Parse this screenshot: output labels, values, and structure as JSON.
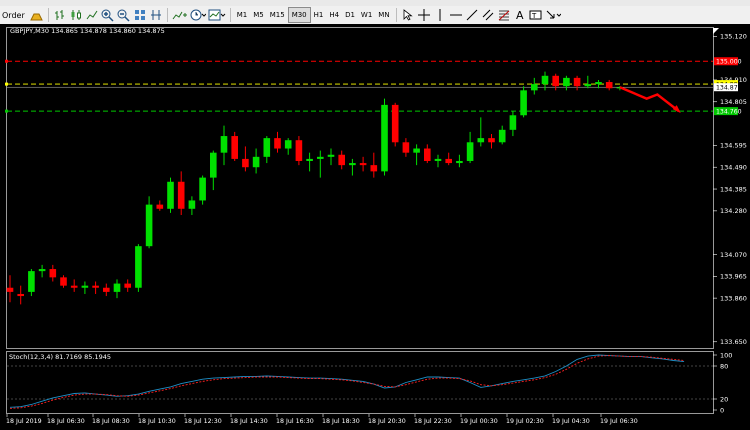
{
  "toolbar": {
    "order_label": "Order",
    "timeframes": [
      "M1",
      "M5",
      "M15",
      "M30",
      "H1",
      "H4",
      "D1",
      "W1",
      "MN"
    ],
    "active_timeframe": "M30",
    "icons": [
      "gold-bars-icon",
      "bar-chart-icon",
      "candlestick-icon",
      "line-chart-icon",
      "zoom-in-icon",
      "zoom-out-icon",
      "tile-windows-icon",
      "period-separators-icon",
      "add-indicator-icon",
      "clock-icon",
      "templates-icon",
      "cursor-icon",
      "crosshair-icon",
      "vertical-line-icon",
      "horizontal-line-icon",
      "trendline-icon",
      "channel-icon",
      "fibonacci-icon",
      "text-icon",
      "text-label-icon",
      "arrows-icon"
    ]
  },
  "chart_info": {
    "symbol_line": "GBPJPY,M30  134.865 134.878 134.860 134.875"
  },
  "indicator_info": {
    "label": "Stoch(12,3,4) 81.7169 85.1945"
  },
  "colors": {
    "background": "#000000",
    "bull": "#00e000",
    "bear": "#ff0000",
    "grid": "#2a2a2a",
    "axis_text": "#ffffff"
  },
  "chart_data": [
    {
      "type": "candlestick",
      "symbol": "GBPJPY",
      "timeframe": "M30",
      "ylim": [
        133.62,
        135.16
      ],
      "y_ticks": [
        135.12,
        134.91,
        134.805,
        134.595,
        134.49,
        134.385,
        134.28,
        134.07,
        133.965,
        133.86,
        133.65
      ],
      "x_ticks": [
        "18 Jul 2019",
        "18 Jul 06:30",
        "18 Jul 08:30",
        "18 Jul 10:30",
        "18 Jul 12:30",
        "18 Jul 14:30",
        "18 Jul 16:30",
        "18 Jul 18:30",
        "18 Jul 20:30",
        "18 Jul 22:30",
        "19 Jul 00:30",
        "19 Jul 02:30",
        "19 Jul 04:30",
        "19 Jul 06:30"
      ],
      "price_labels": [
        {
          "value": "135.000",
          "role": "resistance",
          "color": "#ff0000"
        },
        {
          "value": "134.890",
          "role": "current-bid",
          "color": "#ffff00"
        },
        {
          "value": "134.875",
          "role": "current",
          "color": "#ffffff"
        },
        {
          "value": "134.760",
          "role": "support",
          "color": "#00c800"
        }
      ],
      "levels": [
        {
          "price": 135.0,
          "color": "#ff0000",
          "style": "dashed"
        },
        {
          "price": 134.89,
          "color": "#ffff00",
          "style": "dashed"
        },
        {
          "price": 134.76,
          "color": "#00c800",
          "style": "dashed"
        }
      ],
      "candles": [
        {
          "o": 133.91,
          "h": 133.97,
          "l": 133.84,
          "c": 133.89
        },
        {
          "o": 133.88,
          "h": 133.92,
          "l": 133.83,
          "c": 133.87
        },
        {
          "o": 133.89,
          "h": 134.0,
          "l": 133.87,
          "c": 133.99
        },
        {
          "o": 133.99,
          "h": 134.02,
          "l": 133.96,
          "c": 134.0
        },
        {
          "o": 134.0,
          "h": 134.02,
          "l": 133.94,
          "c": 133.96
        },
        {
          "o": 133.96,
          "h": 133.97,
          "l": 133.91,
          "c": 133.92
        },
        {
          "o": 133.92,
          "h": 133.95,
          "l": 133.89,
          "c": 133.91
        },
        {
          "o": 133.91,
          "h": 133.94,
          "l": 133.88,
          "c": 133.92
        },
        {
          "o": 133.92,
          "h": 133.94,
          "l": 133.88,
          "c": 133.91
        },
        {
          "o": 133.91,
          "h": 133.93,
          "l": 133.87,
          "c": 133.89
        },
        {
          "o": 133.89,
          "h": 133.95,
          "l": 133.86,
          "c": 133.93
        },
        {
          "o": 133.93,
          "h": 133.95,
          "l": 133.89,
          "c": 133.91
        },
        {
          "o": 133.91,
          "h": 134.12,
          "l": 133.89,
          "c": 134.11
        },
        {
          "o": 134.11,
          "h": 134.35,
          "l": 134.1,
          "c": 134.31
        },
        {
          "o": 134.31,
          "h": 134.33,
          "l": 134.28,
          "c": 134.29
        },
        {
          "o": 134.29,
          "h": 134.44,
          "l": 134.27,
          "c": 134.42
        },
        {
          "o": 134.42,
          "h": 134.47,
          "l": 134.26,
          "c": 134.29
        },
        {
          "o": 134.29,
          "h": 134.35,
          "l": 134.26,
          "c": 134.33
        },
        {
          "o": 134.33,
          "h": 134.45,
          "l": 134.31,
          "c": 134.44
        },
        {
          "o": 134.44,
          "h": 134.57,
          "l": 134.38,
          "c": 134.56
        },
        {
          "o": 134.56,
          "h": 134.69,
          "l": 134.5,
          "c": 134.64
        },
        {
          "o": 134.64,
          "h": 134.66,
          "l": 134.52,
          "c": 134.53
        },
        {
          "o": 134.53,
          "h": 134.59,
          "l": 134.47,
          "c": 134.49
        },
        {
          "o": 134.49,
          "h": 134.58,
          "l": 134.46,
          "c": 134.54
        },
        {
          "o": 134.54,
          "h": 134.64,
          "l": 134.51,
          "c": 134.63
        },
        {
          "o": 134.63,
          "h": 134.66,
          "l": 134.56,
          "c": 134.58
        },
        {
          "o": 134.58,
          "h": 134.63,
          "l": 134.55,
          "c": 134.62
        },
        {
          "o": 134.62,
          "h": 134.64,
          "l": 134.5,
          "c": 134.52
        },
        {
          "o": 134.52,
          "h": 134.56,
          "l": 134.47,
          "c": 134.53
        },
        {
          "o": 134.53,
          "h": 134.57,
          "l": 134.44,
          "c": 134.54
        },
        {
          "o": 134.54,
          "h": 134.58,
          "l": 134.5,
          "c": 134.55
        },
        {
          "o": 134.55,
          "h": 134.57,
          "l": 134.48,
          "c": 134.5
        },
        {
          "o": 134.5,
          "h": 134.53,
          "l": 134.45,
          "c": 134.51
        },
        {
          "o": 134.51,
          "h": 134.54,
          "l": 134.47,
          "c": 134.5
        },
        {
          "o": 134.5,
          "h": 134.56,
          "l": 134.44,
          "c": 134.47
        },
        {
          "o": 134.47,
          "h": 134.82,
          "l": 134.45,
          "c": 134.79
        },
        {
          "o": 134.79,
          "h": 134.8,
          "l": 134.59,
          "c": 134.61
        },
        {
          "o": 134.61,
          "h": 134.63,
          "l": 134.54,
          "c": 134.56
        },
        {
          "o": 134.56,
          "h": 134.6,
          "l": 134.5,
          "c": 134.58
        },
        {
          "o": 134.58,
          "h": 134.6,
          "l": 134.51,
          "c": 134.52
        },
        {
          "o": 134.52,
          "h": 134.55,
          "l": 134.49,
          "c": 134.53
        },
        {
          "o": 134.53,
          "h": 134.56,
          "l": 134.5,
          "c": 134.51
        },
        {
          "o": 134.51,
          "h": 134.55,
          "l": 134.49,
          "c": 134.52
        },
        {
          "o": 134.52,
          "h": 134.66,
          "l": 134.51,
          "c": 134.61
        },
        {
          "o": 134.61,
          "h": 134.73,
          "l": 134.59,
          "c": 134.63
        },
        {
          "o": 134.63,
          "h": 134.65,
          "l": 134.58,
          "c": 134.61
        },
        {
          "o": 134.61,
          "h": 134.69,
          "l": 134.6,
          "c": 134.67
        },
        {
          "o": 134.67,
          "h": 134.76,
          "l": 134.64,
          "c": 134.74
        },
        {
          "o": 134.74,
          "h": 134.88,
          "l": 134.73,
          "c": 134.86
        },
        {
          "o": 134.86,
          "h": 134.92,
          "l": 134.84,
          "c": 134.89
        },
        {
          "o": 134.89,
          "h": 134.95,
          "l": 134.86,
          "c": 134.93
        },
        {
          "o": 134.93,
          "h": 134.94,
          "l": 134.86,
          "c": 134.88
        },
        {
          "o": 134.88,
          "h": 134.93,
          "l": 134.86,
          "c": 134.92
        },
        {
          "o": 134.92,
          "h": 134.93,
          "l": 134.86,
          "c": 134.88
        },
        {
          "o": 134.88,
          "h": 134.93,
          "l": 134.87,
          "c": 134.89
        },
        {
          "o": 134.89,
          "h": 134.91,
          "l": 134.87,
          "c": 134.9
        },
        {
          "o": 134.9,
          "h": 134.91,
          "l": 134.86,
          "c": 134.87
        },
        {
          "o": 134.87,
          "h": 134.88,
          "l": 134.86,
          "c": 134.875
        }
      ],
      "projection": {
        "color": "#ff0000",
        "points": [
          [
            134.875,
            0
          ],
          [
            134.82,
            2.5
          ],
          [
            134.84,
            3.5
          ],
          [
            134.76,
            5.5
          ]
        ]
      }
    },
    {
      "type": "line",
      "name": "Stoch(12,3,4)",
      "ylim": [
        0,
        100
      ],
      "y_ticks": [
        100,
        80,
        20,
        0
      ],
      "levels": [
        80,
        20
      ],
      "series": [
        {
          "name": "main",
          "color": "#1e90c8",
          "style": "solid",
          "values": [
            5,
            6,
            10,
            16,
            22,
            26,
            30,
            31,
            29,
            27,
            25,
            26,
            29,
            34,
            38,
            42,
            48,
            52,
            56,
            58,
            59,
            60,
            61,
            61,
            62,
            61,
            60,
            59,
            58,
            58,
            57,
            56,
            54,
            52,
            47,
            40,
            42,
            50,
            55,
            60,
            60,
            59,
            58,
            50,
            41,
            44,
            48,
            52,
            55,
            58,
            62,
            70,
            80,
            92,
            98,
            100,
            99,
            98,
            97,
            97,
            95,
            93,
            90,
            88
          ]
        },
        {
          "name": "signal",
          "color": "#ff2020",
          "style": "dashed",
          "values": [
            3,
            4,
            7,
            12,
            18,
            23,
            27,
            29,
            29,
            28,
            26,
            25,
            27,
            31,
            35,
            39,
            44,
            48,
            52,
            55,
            57,
            58,
            59,
            60,
            60,
            60,
            59,
            58,
            57,
            57,
            56,
            55,
            53,
            50,
            47,
            43,
            42,
            46,
            51,
            56,
            58,
            58,
            57,
            53,
            46,
            44,
            46,
            49,
            52,
            55,
            59,
            65,
            74,
            85,
            93,
            98,
            99,
            98,
            97,
            97,
            96,
            94,
            92,
            90
          ]
        }
      ]
    }
  ]
}
